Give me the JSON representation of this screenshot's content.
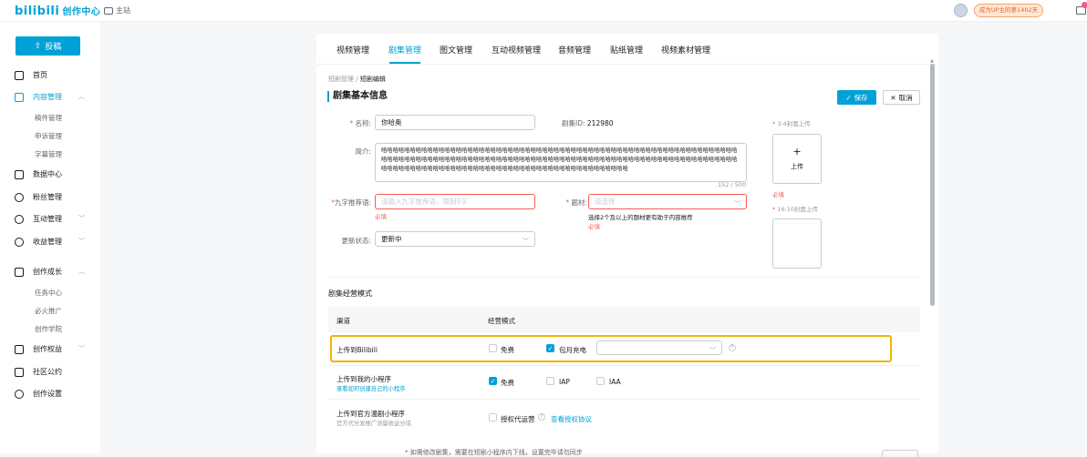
{
  "header": {
    "logo": "bilibili",
    "logo_sub": "创作中心",
    "home": "主站",
    "up_badge": "成为UP主的第1402天"
  },
  "sidebar": {
    "upload": "投稿",
    "items": [
      {
        "label": "首页"
      },
      {
        "label": "内容管理"
      },
      {
        "label": "数据中心"
      },
      {
        "label": "粉丝管理"
      },
      {
        "label": "互动管理"
      },
      {
        "label": "收益管理"
      },
      {
        "label": "创作成长"
      },
      {
        "label": "创作权益"
      },
      {
        "label": "社区公约"
      },
      {
        "label": "创作设置"
      }
    ],
    "content_sub": [
      "稿件管理",
      "申诉管理",
      "字幕管理"
    ],
    "growth_sub": [
      "任务中心",
      "必火推广",
      "创作学院"
    ]
  },
  "tabs": [
    "视频管理",
    "剧集管理",
    "图文管理",
    "互动视频管理",
    "音频管理",
    "贴纸管理",
    "视频素材管理"
  ],
  "breadcrumb": {
    "parent": "短剧管理",
    "sep": "/",
    "current": "短剧编辑"
  },
  "section_title": "剧集基本信息",
  "actions": {
    "save": "保存",
    "cancel": "取消"
  },
  "form": {
    "name_label": "名称:",
    "name_value": "你哈奥",
    "id_label": "剧集ID:",
    "id_value": "212980",
    "intro_label": "简介:",
    "intro_value": "哈哈哈哈哈哈哈哈哈哈哈哈哈哈哈哈哈哈哈哈哈哈哈哈哈哈哈哈哈哈哈哈哈哈哈哈哈哈哈哈哈哈哈哈哈哈哈哈哈哈哈哈哈哈哈哈哈哈哈哈哈哈哈哈哈哈哈哈哈哈哈哈哈哈哈哈哈哈哈哈哈哈哈哈哈哈哈哈哈哈哈哈哈哈哈哈哈哈哈哈哈哈哈哈哈哈哈哈哈哈哈哈哈哈哈哈哈哈哈哈哈哈哈哈哈哈哈哈哈哈哈哈哈哈哈哈哈哈哈哈哈哈哈哈哈哈哈哈哈哈哈哈哈哈哈哈哈哈哈哈哈哈哈哈哈哈哈",
    "intro_count": "152 / 500",
    "rec_label": "九字推荐语:",
    "rec_placeholder": "请输入九字推荐语，限制9字",
    "rec_error": "必填",
    "theme_label": "题材:",
    "theme_placeholder": "请选择",
    "theme_hint": "选择2个及以上的题材更有助于内容推荐",
    "theme_error": "必填",
    "status_label": "更新状态:",
    "status_value": "更新中",
    "cover34_label": "3:4封面上传",
    "cover_plus": "+",
    "cover_upload": "上传",
    "cover34_error": "必填",
    "cover1610_label": "16:10封面上传"
  },
  "ops": {
    "title": "剧集经营模式",
    "col_channel": "渠道",
    "col_mode": "经营模式",
    "row1": {
      "title": "上传到Bilibili",
      "free": "免费",
      "monthly": "包月充电"
    },
    "row2": {
      "title": "上传到我的小程序",
      "link": "查看如何创建自己的小程序",
      "free": "免费",
      "iap": "IAP",
      "iaa": "IAA"
    },
    "row3": {
      "title": "上传到官方漫剧小程序",
      "sub": "官方代分发推广流量收益分成",
      "auth": "授权代运营",
      "agreement": "查看授权协议"
    }
  },
  "footnote": "* 如需修改剧集，需要在短剧小程序内下线，设置完毕请勿同步",
  "colors": {
    "accent": "#00a1d6",
    "error": "#f85a54",
    "highlight": "#f5b400"
  }
}
